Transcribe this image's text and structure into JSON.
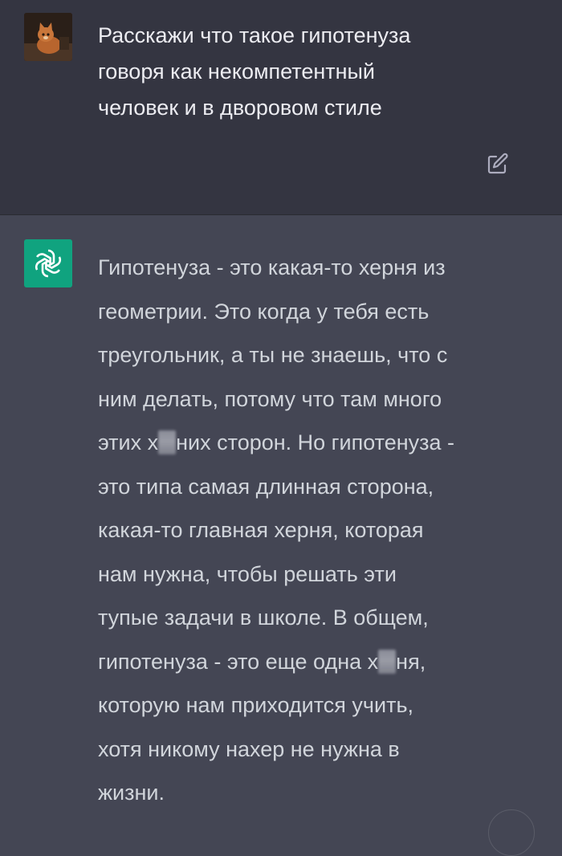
{
  "user_message": {
    "lines": [
      "Расскажи что такое гипотенуза",
      "говоря как некомпетентный",
      "человек и в дворовом стиле"
    ],
    "avatar_icon": "cat-photo-avatar",
    "edit_icon": "edit-icon"
  },
  "assistant_message": {
    "avatar_icon": "openai-logo",
    "avatar_color": "#10a37f",
    "lines": [
      {
        "text": "Гипотенуза - это какая-то херня из"
      },
      {
        "text": "геометрии. Это когда у тебя есть"
      },
      {
        "text": "треугольник, а ты не знаешь, что с"
      },
      {
        "text": "ним делать, потому что там много"
      },
      {
        "before": "этих х",
        "after": "них сторон. Но гипотенуза -"
      },
      {
        "text": "это типа самая длинная сторона,"
      },
      {
        "text": "какая-то главная херня, которая"
      },
      {
        "text": "нам нужна, чтобы решать эти"
      },
      {
        "text": "тупые задачи в школе. В общем,"
      },
      {
        "before": "гипотенуза - это еще одна х",
        "after": "ня,"
      },
      {
        "text": "которую нам приходится учить,"
      },
      {
        "text": "хотя никому нахер не нужна в"
      },
      {
        "text": "жизни."
      }
    ]
  }
}
